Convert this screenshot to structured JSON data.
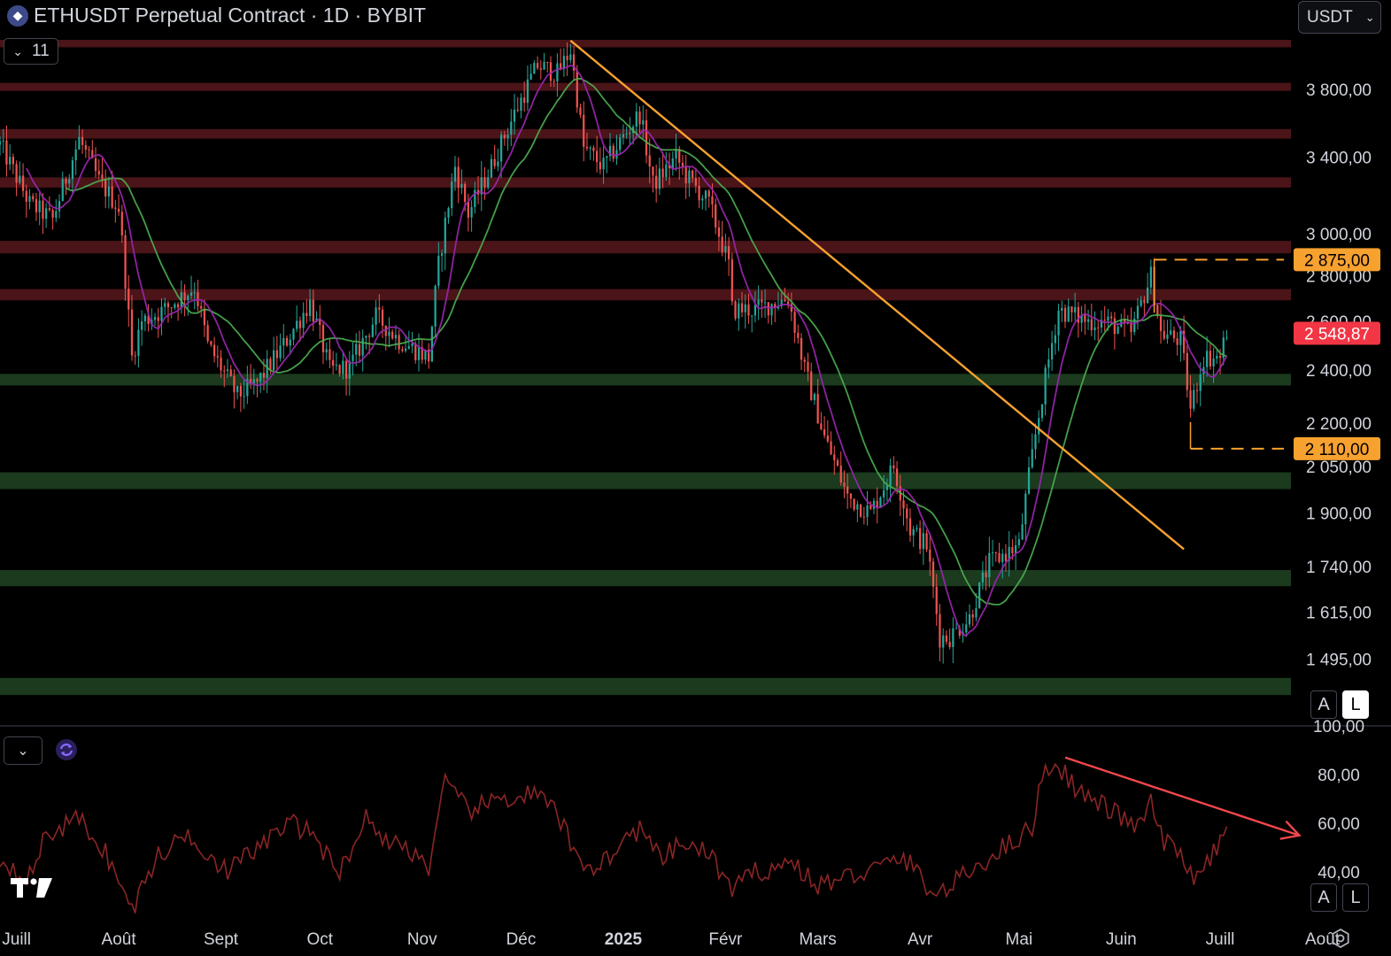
{
  "header": {
    "title": "ETHUSDT Perpetual Contract · 1D · BYBIT",
    "currency": "USDT",
    "indicator_count": "11"
  },
  "buttons": {
    "auto": "A",
    "log": "L"
  },
  "colors": {
    "background": "#000000",
    "up_candle": "#26a69a",
    "down_candle": "#ef5350",
    "ma_fast": "#9c27b0",
    "ma_slow": "#4caf50",
    "trendline": "#f7a12f",
    "resistance_zone": "#4a1418",
    "support_zone": "#1b3a1e",
    "rsi_line": "#8b2525",
    "rsi_arrow": "#f0474d",
    "last_price_badge": "#f23645",
    "level_badge": "#f7a12f"
  },
  "chart_data": [
    {
      "type": "candlestick",
      "title": "ETHUSDT Perpetual Contract · 1D · BYBIT",
      "scale": "log",
      "ylim": [
        1380,
        4150
      ],
      "y_ticks": [
        "3 800,00",
        "3 400,00",
        "3 000,00",
        "2 800,00",
        "2 600,00",
        "2 400,00",
        "2 200,00",
        "2 050,00",
        "1 900,00",
        "1 740,00",
        "1 615,00",
        "1 495,00"
      ],
      "x_ticks": [
        "Juill",
        "Août",
        "Sept",
        "Oct",
        "Nov",
        "Déc",
        "2025",
        "Févr",
        "Mars",
        "Avr",
        "Mai",
        "Juin",
        "Juill",
        "Août"
      ],
      "x_range": [
        "2024-06-26",
        "2025-08-21"
      ],
      "last_price": "2 548,87",
      "levels": [
        {
          "label": "2 875,00",
          "value": 2875,
          "from": "2025-06-11"
        },
        {
          "label": "2 110,00",
          "value": 2110,
          "from": "2025-06-22"
        }
      ],
      "resistance_zones": [
        [
          4070,
          4120
        ],
        [
          3790,
          3840
        ],
        [
          3505,
          3560
        ],
        [
          3235,
          3290
        ],
        [
          2905,
          2965
        ],
        [
          2690,
          2740
        ]
      ],
      "support_zones": [
        [
          2340,
          2385
        ],
        [
          1975,
          2030
        ],
        [
          1685,
          1730
        ],
        [
          1410,
          1450
        ]
      ],
      "trendline": {
        "start": [
          "2024-12-16",
          4115
        ],
        "end": [
          "2025-06-20",
          1790
        ]
      },
      "price_anchors": [
        [
          "2024-06-26",
          3470
        ],
        [
          "2024-07-05",
          3150
        ],
        [
          "2024-07-12",
          3070
        ],
        [
          "2024-07-20",
          3500
        ],
        [
          "2024-07-26",
          3270
        ],
        [
          "2024-08-01",
          3130
        ],
        [
          "2024-08-05",
          2450
        ],
        [
          "2024-08-08",
          2600
        ],
        [
          "2024-08-15",
          2650
        ],
        [
          "2024-08-24",
          2750
        ],
        [
          "2024-08-28",
          2500
        ],
        [
          "2024-09-06",
          2300
        ],
        [
          "2024-09-12",
          2350
        ],
        [
          "2024-09-20",
          2500
        ],
        [
          "2024-09-28",
          2680
        ],
        [
          "2024-10-04",
          2400
        ],
        [
          "2024-10-10",
          2410
        ],
        [
          "2024-10-18",
          2620
        ],
        [
          "2024-10-25",
          2520
        ],
        [
          "2024-11-03",
          2450
        ],
        [
          "2024-11-06",
          2850
        ],
        [
          "2024-11-11",
          3350
        ],
        [
          "2024-11-15",
          3100
        ],
        [
          "2024-11-22",
          3350
        ],
        [
          "2024-11-29",
          3650
        ],
        [
          "2024-12-06",
          3950
        ],
        [
          "2024-12-12",
          3900
        ],
        [
          "2024-12-16",
          4050
        ],
        [
          "2024-12-20",
          3450
        ],
        [
          "2024-12-26",
          3350
        ],
        [
          "2025-01-06",
          3650
        ],
        [
          "2025-01-10",
          3250
        ],
        [
          "2025-01-17",
          3400
        ],
        [
          "2025-01-20",
          3300
        ],
        [
          "2025-01-27",
          3150
        ],
        [
          "2025-02-02",
          2850
        ],
        [
          "2025-02-03",
          2650
        ],
        [
          "2025-02-10",
          2650
        ],
        [
          "2025-02-20",
          2700
        ],
        [
          "2025-02-25",
          2400
        ],
        [
          "2025-03-03",
          2150
        ],
        [
          "2025-03-10",
          1950
        ],
        [
          "2025-03-17",
          1900
        ],
        [
          "2025-03-24",
          2050
        ],
        [
          "2025-03-29",
          1850
        ],
        [
          "2025-04-03",
          1800
        ],
        [
          "2025-04-07",
          1550
        ],
        [
          "2025-04-10",
          1550
        ],
        [
          "2025-04-16",
          1600
        ],
        [
          "2025-04-22",
          1750
        ],
        [
          "2025-05-01",
          1800
        ],
        [
          "2025-05-08",
          2300
        ],
        [
          "2025-05-13",
          2650
        ],
        [
          "2025-05-22",
          2600
        ],
        [
          "2025-05-27",
          2600
        ],
        [
          "2025-06-04",
          2550
        ],
        [
          "2025-06-10",
          2800
        ],
        [
          "2025-06-13",
          2550
        ],
        [
          "2025-06-19",
          2520
        ],
        [
          "2025-06-22",
          2250
        ],
        [
          "2025-06-26",
          2450
        ],
        [
          "2025-07-01",
          2450
        ],
        [
          "2025-07-03",
          2560
        ]
      ],
      "series": [
        {
          "kind": "moving-average",
          "period": 9
        },
        {
          "kind": "moving-average",
          "period": 21
        }
      ]
    },
    {
      "type": "line",
      "ylim": [
        20,
        100
      ],
      "y_ticks": [
        "100,00",
        "80,00",
        "60,00",
        "40,00"
      ],
      "anchors": [
        [
          "2024-06-26",
          45
        ],
        [
          "2024-07-05",
          38
        ],
        [
          "2024-07-10",
          55
        ],
        [
          "2024-07-20",
          62
        ],
        [
          "2024-07-28",
          48
        ],
        [
          "2024-08-05",
          24
        ],
        [
          "2024-08-12",
          45
        ],
        [
          "2024-08-22",
          56
        ],
        [
          "2024-09-03",
          40
        ],
        [
          "2024-09-12",
          50
        ],
        [
          "2024-09-22",
          60
        ],
        [
          "2024-09-30",
          55
        ],
        [
          "2024-10-06",
          38
        ],
        [
          "2024-10-15",
          62
        ],
        [
          "2024-10-22",
          52
        ],
        [
          "2024-10-28",
          50
        ],
        [
          "2024-11-03",
          42
        ],
        [
          "2024-11-08",
          76
        ],
        [
          "2024-11-15",
          65
        ],
        [
          "2024-11-25",
          70
        ],
        [
          "2024-12-05",
          72
        ],
        [
          "2024-12-12",
          64
        ],
        [
          "2024-12-18",
          45
        ],
        [
          "2024-12-24",
          42
        ],
        [
          "2025-01-06",
          58
        ],
        [
          "2025-01-12",
          45
        ],
        [
          "2025-01-20",
          52
        ],
        [
          "2025-01-28",
          46
        ],
        [
          "2025-02-03",
          32
        ],
        [
          "2025-02-10",
          40
        ],
        [
          "2025-02-22",
          44
        ],
        [
          "2025-02-28",
          34
        ],
        [
          "2025-03-10",
          38
        ],
        [
          "2025-03-20",
          42
        ],
        [
          "2025-03-27",
          46
        ],
        [
          "2025-04-06",
          30
        ],
        [
          "2025-04-14",
          38
        ],
        [
          "2025-04-24",
          48
        ],
        [
          "2025-05-05",
          58
        ],
        [
          "2025-05-08",
          80
        ],
        [
          "2025-05-12",
          85
        ],
        [
          "2025-05-20",
          72
        ],
        [
          "2025-05-28",
          66
        ],
        [
          "2025-06-06",
          58
        ],
        [
          "2025-06-10",
          68
        ],
        [
          "2025-06-14",
          52
        ],
        [
          "2025-06-20",
          46
        ],
        [
          "2025-06-24",
          36
        ],
        [
          "2025-06-30",
          50
        ],
        [
          "2025-07-03",
          56
        ]
      ],
      "annotation": {
        "kind": "divergence-arrow",
        "start": [
          "2025-05-15",
          87
        ],
        "end": [
          "2025-07-25",
          55
        ]
      }
    }
  ]
}
